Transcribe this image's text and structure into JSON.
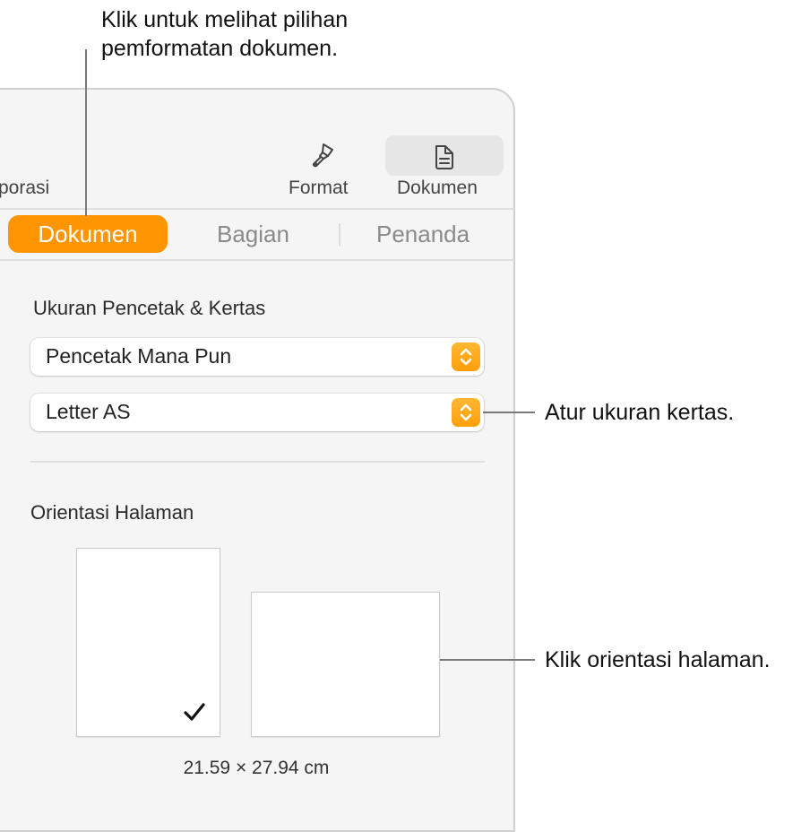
{
  "callouts": {
    "top": [
      "Klik untuk melihat pilihan",
      "pemformatan dokumen."
    ],
    "paper_size": "Atur ukuran kertas.",
    "orientation": "Klik orientasi halaman."
  },
  "toolbar": {
    "partial_left_label": "porasi",
    "format": {
      "label": "Format",
      "icon": "paintbrush-icon"
    },
    "document": {
      "label": "Dokumen",
      "icon": "document-icon",
      "selected": true
    }
  },
  "tabs": [
    {
      "label": "Dokumen",
      "active": true
    },
    {
      "label": "Bagian",
      "active": false
    },
    {
      "label": "Penanda",
      "active": false
    }
  ],
  "printer_paper": {
    "title": "Ukuran Pencetak & Kertas",
    "printer": "Pencetak Mana Pun",
    "paper_size": "Letter AS"
  },
  "orientation": {
    "title": "Orientasi Halaman",
    "options": [
      {
        "name": "portrait",
        "selected": true
      },
      {
        "name": "landscape",
        "selected": false
      }
    ],
    "dimensions": "21.59 × 27.94 cm"
  },
  "colors": {
    "accent": "#ff9500",
    "panel_bg": "#f5f5f5"
  }
}
